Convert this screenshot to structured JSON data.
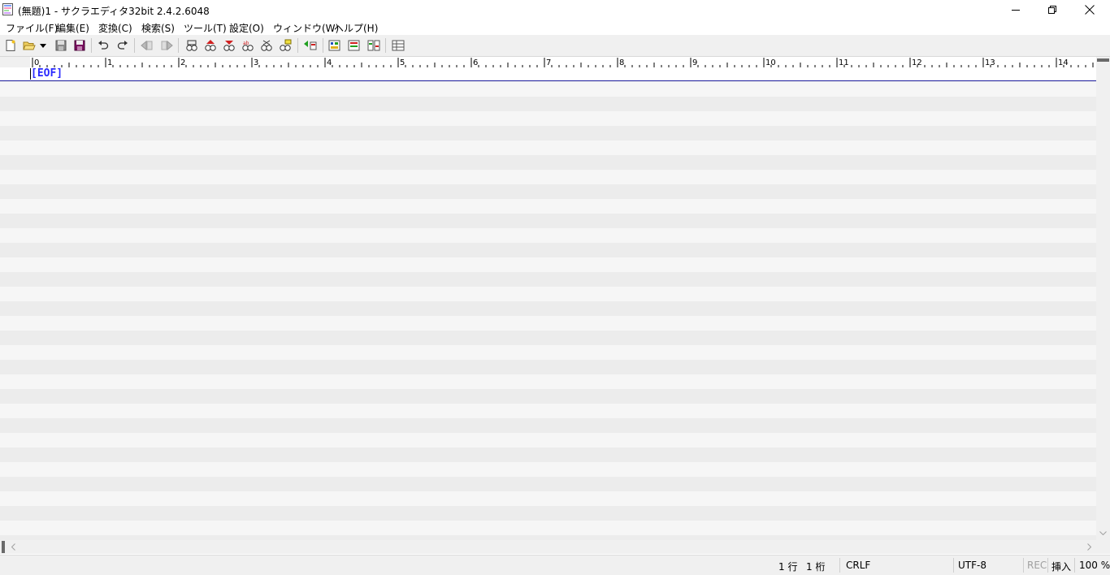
{
  "window": {
    "title": "(無題)1 - サクラエディタ32bit 2.4.2.6048",
    "controls": [
      "minimize",
      "restore",
      "close"
    ]
  },
  "menu": {
    "items": [
      {
        "label": "ファイル(F)"
      },
      {
        "label": "編集(E)"
      },
      {
        "label": "変換(C)"
      },
      {
        "label": "検索(S)"
      },
      {
        "label": "ツール(T)"
      },
      {
        "label": "設定(O)"
      },
      {
        "label": "ウィンドウ(W)"
      },
      {
        "label": "ヘルプ(H)"
      }
    ]
  },
  "toolbar": {
    "buttons": [
      {
        "icon": "new-file-icon"
      },
      {
        "icon": "open-file-icon"
      },
      {
        "icon": "dropdown-arrow-icon"
      },
      {
        "icon": "save-icon"
      },
      {
        "icon": "save-all-icon"
      },
      {
        "icon": "undo-icon"
      },
      {
        "icon": "redo-icon"
      },
      {
        "icon": "move-back-icon"
      },
      {
        "icon": "move-forward-icon"
      },
      {
        "icon": "search-icon"
      },
      {
        "icon": "search-prev-icon"
      },
      {
        "icon": "search-next-icon"
      },
      {
        "icon": "replace-icon"
      },
      {
        "icon": "search-mark-icon"
      },
      {
        "icon": "grep-icon"
      },
      {
        "icon": "jump-icon"
      },
      {
        "icon": "outline-icon"
      },
      {
        "icon": "compare-icon"
      },
      {
        "icon": "diff-icon"
      },
      {
        "icon": "settings-icon"
      }
    ]
  },
  "ruler": {
    "labels": [
      "0",
      "1",
      "2",
      "3",
      "4",
      "5",
      "6",
      "7",
      "8",
      "9",
      "10",
      "11",
      "12",
      "13",
      "14"
    ]
  },
  "editor": {
    "eof_marker": "[EOF]"
  },
  "status": {
    "line": "1 行",
    "column": "1 桁",
    "line_ending": "CRLF",
    "encoding": "UTF-8",
    "rec": "REC",
    "mode": "挿入",
    "zoom": "100 %"
  },
  "colors": {
    "eof": "#2a2aff",
    "line_underline": "#2020a0",
    "stripe_dark": "#ececec",
    "stripe_light": "#f6f6f6"
  }
}
